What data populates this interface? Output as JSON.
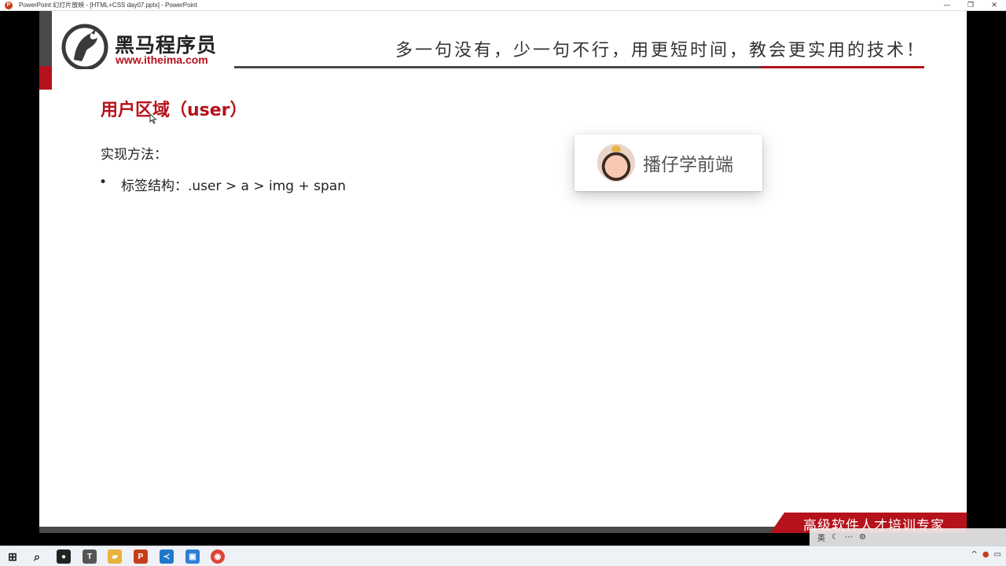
{
  "window": {
    "title": "PowerPoint 幻灯片放映 - [HTML+CSS day07.pptx] - PowerPoint",
    "app_icon_letter": "P",
    "controls": {
      "minimize": "—",
      "restore": "❐",
      "close": "✕"
    }
  },
  "slide": {
    "brand": {
      "name": "黑马程序员",
      "url": "www.itheima.com"
    },
    "slogan": "多一句没有，少一句不行，用更短时间，教会更实用的技术！",
    "heading": "用户区域（user）",
    "method_label": "实现方法：",
    "bullets": [
      {
        "marker": "•",
        "text": "标签结构：.user > a > img + span"
      }
    ],
    "demo_card": {
      "name": "播仔学前端"
    },
    "footer_text": "高级软件人才培训专家"
  },
  "taskbar": {
    "apps": [
      {
        "name": "windows-start",
        "glyph": "⊞",
        "color": "#1a1a1a"
      },
      {
        "name": "search",
        "glyph": "⌕",
        "color": "#1a1a1a"
      },
      {
        "name": "app-obs",
        "glyph": "●",
        "color": "#222222"
      },
      {
        "name": "app-typora",
        "glyph": "T",
        "color": "#555555"
      },
      {
        "name": "app-explorer",
        "glyph": "▰",
        "color": "#e8b23a"
      },
      {
        "name": "app-powerpoint",
        "glyph": "P",
        "color": "#c43e1c"
      },
      {
        "name": "app-vscode",
        "glyph": "≺",
        "color": "#1f79c9"
      },
      {
        "name": "app-notes",
        "glyph": "▣",
        "color": "#2f7fd6"
      },
      {
        "name": "app-chrome",
        "glyph": "◉",
        "color": "#db4437"
      }
    ],
    "tray": {
      "ime": "英",
      "chevron": "^"
    }
  }
}
